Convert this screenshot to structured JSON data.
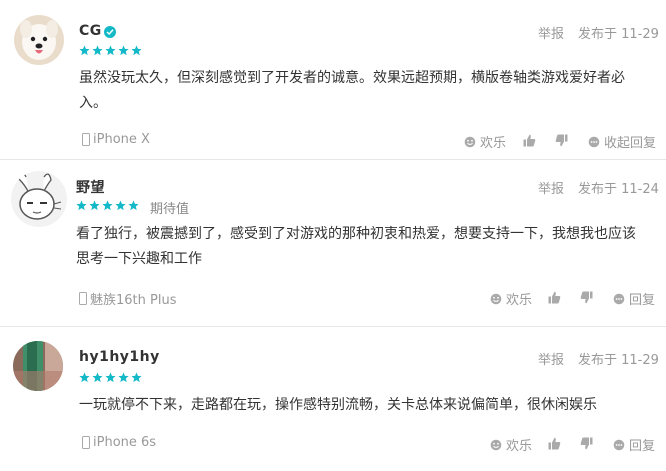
{
  "reviews": [
    {
      "username": "CG",
      "verified": true,
      "rating": 5,
      "rating_label": "",
      "report_label": "举报",
      "date": "发布于 11-29",
      "content_lines": [
        "虽然没玩太久，但深刻感觉到了开发者的诚意。效果远超预期，横版卷轴类游戏爱好者必",
        "入。"
      ],
      "device": "iPhone X",
      "funny_label": "欢乐",
      "reply_label": "收起回复"
    },
    {
      "username": "野望",
      "verified": false,
      "rating": 5,
      "rating_label": "期待值",
      "report_label": "举报",
      "date": "发布于 11-24",
      "content_lines": [
        "看了独行，被震撼到了，感受到了对游戏的那种初衷和热爱，想要支持一下，我想我也应该",
        "思考一下兴趣和工作"
      ],
      "device": "魅族16th Plus",
      "funny_label": "欢乐",
      "reply_label": "回复"
    },
    {
      "username": "hy1hy1hy",
      "verified": false,
      "rating": 5,
      "rating_label": "",
      "report_label": "举报",
      "date": "发布于 11-29",
      "content_lines": [
        "一玩就停不下来，走路都在玩，操作感特别流畅，关卡总体来说偏简单，很休闲娱乐"
      ],
      "device": "iPhone 6s",
      "funny_label": "欢乐",
      "reply_label": "回复"
    }
  ],
  "colors": {
    "accent": "#14b9c8",
    "text": "#333333",
    "muted": "#999999"
  },
  "icons": [
    "verified-icon",
    "star-icon",
    "phone-icon",
    "smile-icon",
    "thumb-up-icon",
    "thumb-down-icon",
    "reply-icon"
  ]
}
